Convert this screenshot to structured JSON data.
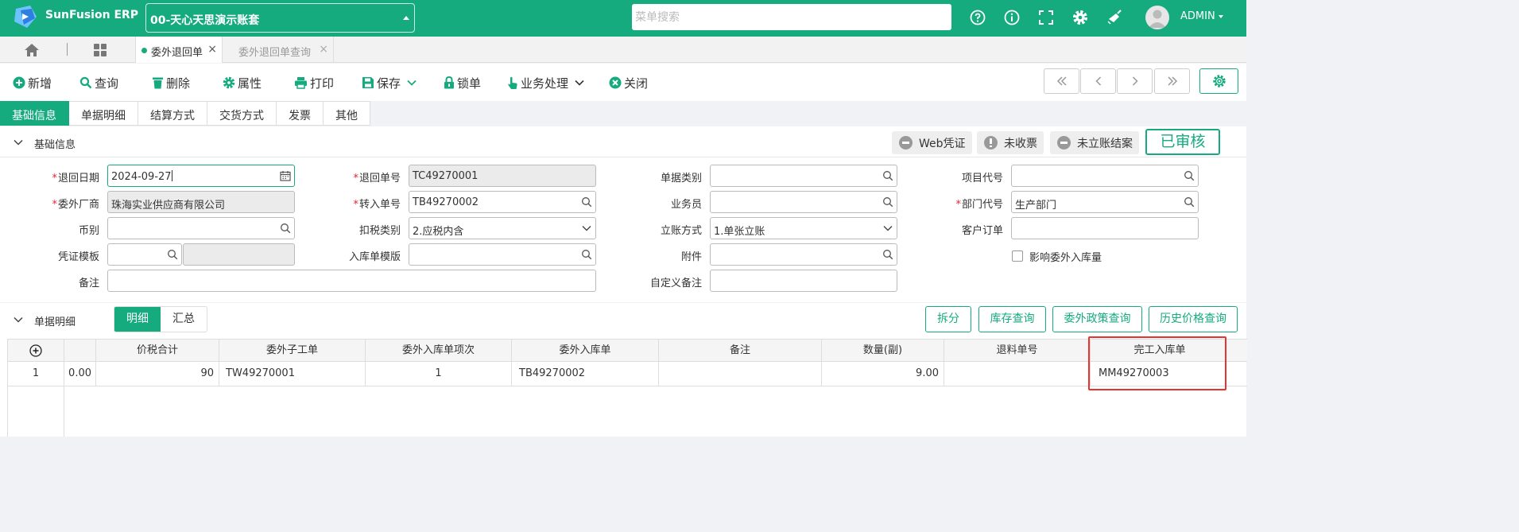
{
  "app": {
    "name": "SunFusion ERP",
    "account": "00-天心天思演示账套",
    "search_placeholder": "菜单搜索",
    "user": "ADMIN"
  },
  "colors": {
    "brand": "#16ab7f",
    "required": "#e23",
    "highlight": "#e8332f"
  },
  "header_icons": [
    "help-icon",
    "info-icon",
    "fullscreen-icon",
    "gear-icon",
    "clean-icon"
  ],
  "tabs": [
    {
      "label": "委外退回单",
      "active": true
    },
    {
      "label": "委外退回单查询",
      "active": false
    }
  ],
  "toolbar": {
    "new": "新增",
    "query": "查询",
    "delete": "删除",
    "props": "属性",
    "print": "打印",
    "save": "保存",
    "lock": "锁单",
    "business": "业务处理",
    "close": "关闭"
  },
  "section_tabs": [
    "基础信息",
    "单据明细",
    "结算方式",
    "交货方式",
    "发票",
    "其他"
  ],
  "basic": {
    "title": "基础信息",
    "status": {
      "web_voucher": "Web凭证",
      "unpaid": "未收票",
      "unsettled": "未立账结案",
      "approved": "已审核"
    },
    "fields": {
      "return_date": {
        "label": "退回日期",
        "value": "2024-09-27"
      },
      "return_no": {
        "label": "退回单号",
        "value": "TC49270001"
      },
      "doc_type": {
        "label": "单据类别",
        "value": ""
      },
      "project_code": {
        "label": "项目代号",
        "value": ""
      },
      "vendor": {
        "label": "委外厂商",
        "value": "珠海实业供应商有限公司"
      },
      "transfer_no": {
        "label": "转入单号",
        "value": "TB49270002"
      },
      "salesman": {
        "label": "业务员",
        "value": ""
      },
      "dept_code": {
        "label": "部门代号",
        "value": "生产部门"
      },
      "currency": {
        "label": "币别",
        "value": ""
      },
      "tax_type": {
        "label": "扣税类别",
        "value": "2.应税内含"
      },
      "account_method": {
        "label": "立账方式",
        "value": "1.单张立账"
      },
      "customer_order": {
        "label": "客户订单",
        "value": ""
      },
      "voucher_tpl": {
        "label": "凭证模板",
        "value": "",
        "value2": ""
      },
      "inbound_tpl": {
        "label": "入库单模版",
        "value": ""
      },
      "attachment": {
        "label": "附件",
        "value": ""
      },
      "affect_inbound": {
        "label": "影响委外入库量",
        "checked": false
      },
      "remark": {
        "label": "备注",
        "value": ""
      },
      "custom_remark": {
        "label": "自定义备注",
        "value": ""
      }
    }
  },
  "detail": {
    "title": "单据明细",
    "views": [
      "明细",
      "汇总"
    ],
    "actions": [
      "拆分",
      "库存查询",
      "委外政策查询",
      "历史价格查询"
    ],
    "columns": [
      "价税合计",
      "委外子工单",
      "委外入库单项次",
      "委外入库单",
      "备注",
      "数量(副)",
      "退料单号",
      "完工入库单"
    ],
    "rows": [
      {
        "no": "1",
        "pre": "0.00",
        "total": "90",
        "sub_wo": "TW49270001",
        "item_no": "1",
        "inbound": "TB49270002",
        "remark": "",
        "qty": "9.00",
        "return_no": "",
        "finish_inbound": "MM49270003"
      }
    ]
  }
}
